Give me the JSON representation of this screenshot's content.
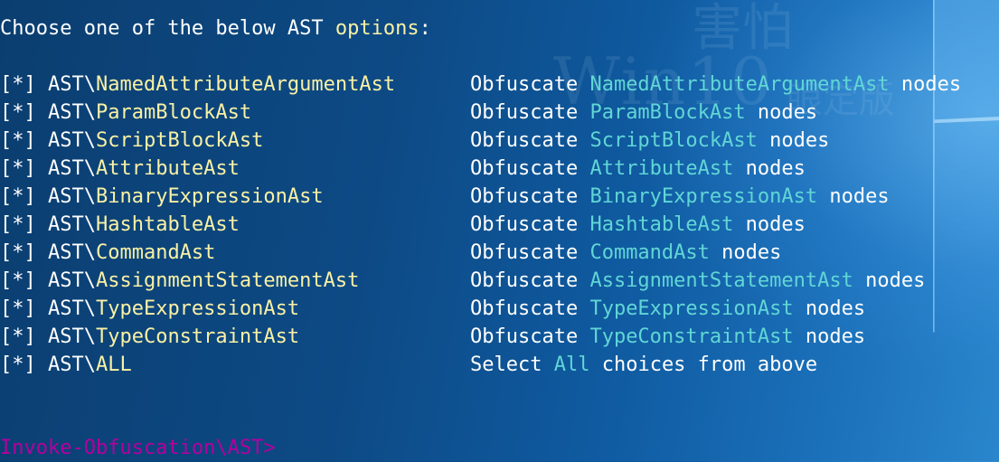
{
  "header": {
    "prefix": "Choose one of the below AST ",
    "highlight": "options",
    "suffix": ":"
  },
  "rows": [
    {
      "bullet": "[*] ",
      "prefix": "AST\\",
      "name": "NamedAttributeArgumentAst",
      "desc_prefix": "Obfuscate ",
      "desc_name": "NamedAttributeArgumentAst",
      "desc_suffix": " nodes"
    },
    {
      "bullet": "[*] ",
      "prefix": "AST\\",
      "name": "ParamBlockAst",
      "desc_prefix": "Obfuscate ",
      "desc_name": "ParamBlockAst",
      "desc_suffix": " nodes"
    },
    {
      "bullet": "[*] ",
      "prefix": "AST\\",
      "name": "ScriptBlockAst",
      "desc_prefix": "Obfuscate ",
      "desc_name": "ScriptBlockAst",
      "desc_suffix": " nodes"
    },
    {
      "bullet": "[*] ",
      "prefix": "AST\\",
      "name": "AttributeAst",
      "desc_prefix": "Obfuscate ",
      "desc_name": "AttributeAst",
      "desc_suffix": " nodes"
    },
    {
      "bullet": "[*] ",
      "prefix": "AST\\",
      "name": "BinaryExpressionAst",
      "desc_prefix": "Obfuscate ",
      "desc_name": "BinaryExpressionAst",
      "desc_suffix": " nodes"
    },
    {
      "bullet": "[*] ",
      "prefix": "AST\\",
      "name": "HashtableAst",
      "desc_prefix": "Obfuscate ",
      "desc_name": "HashtableAst",
      "desc_suffix": " nodes"
    },
    {
      "bullet": "[*] ",
      "prefix": "AST\\",
      "name": "CommandAst",
      "desc_prefix": "Obfuscate ",
      "desc_name": "CommandAst",
      "desc_suffix": " nodes"
    },
    {
      "bullet": "[*] ",
      "prefix": "AST\\",
      "name": "AssignmentStatementAst",
      "desc_prefix": "Obfuscate ",
      "desc_name": "AssignmentStatementAst",
      "desc_suffix": " nodes"
    },
    {
      "bullet": "[*] ",
      "prefix": "AST\\",
      "name": "TypeExpressionAst",
      "desc_prefix": "Obfuscate ",
      "desc_name": "TypeExpressionAst",
      "desc_suffix": " nodes"
    },
    {
      "bullet": "[*] ",
      "prefix": "AST\\",
      "name": "TypeConstraintAst",
      "desc_prefix": "Obfuscate ",
      "desc_name": "TypeConstraintAst",
      "desc_suffix": " nodes"
    },
    {
      "bullet": "[*] ",
      "prefix": "AST\\",
      "name": "ALL",
      "desc_prefix": "Select ",
      "desc_name": "All",
      "desc_suffix": " choices from above"
    }
  ],
  "prompt": "Invoke-Obfuscation\\AST>",
  "watermark": {
    "main": "Win10",
    "top": "害怕",
    "sub": "眼定版"
  },
  "colors": {
    "text": "#ffffff",
    "option_name": "#f9f1a5",
    "desc_name": "#61d6d6",
    "prompt": "#b4009e"
  }
}
